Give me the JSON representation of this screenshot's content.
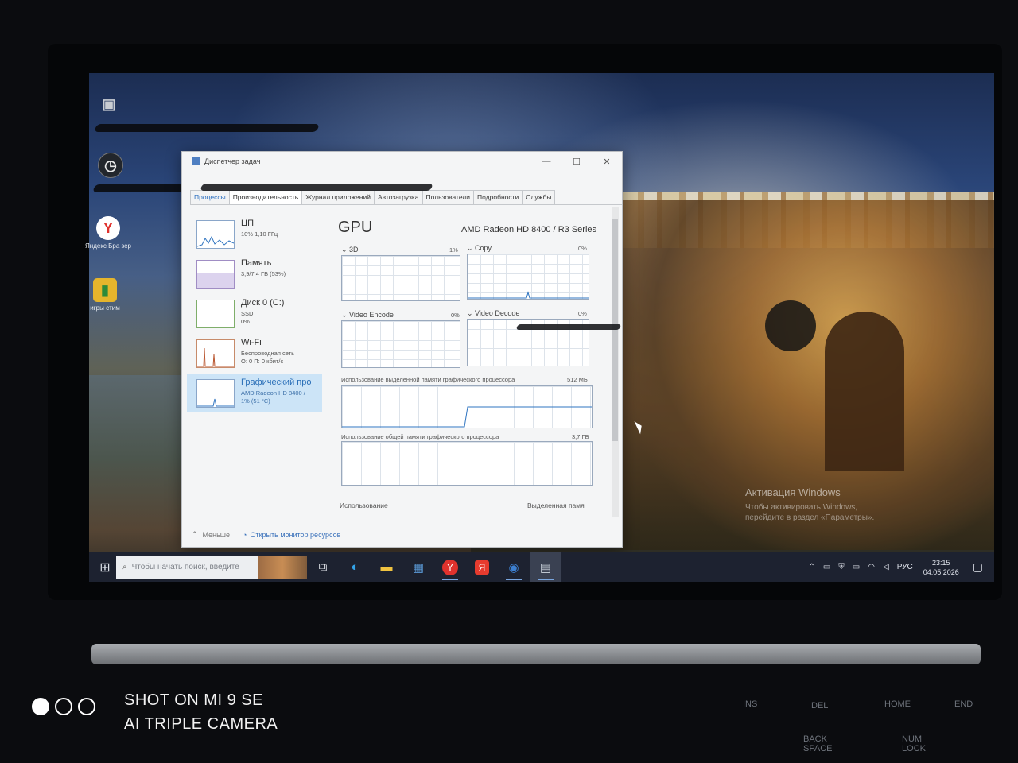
{
  "desktop": {
    "icons": [
      {
        "label": "",
        "glyph": "▣"
      },
      {
        "label": "",
        "glyph": "◷"
      },
      {
        "label": "Яндекс Бра зер",
        "glyph": "Y"
      },
      {
        "label": "игры стим",
        "glyph": "▮"
      }
    ],
    "activation_title": "Активация Windows",
    "activation_text": "Чтобы активировать Windows, перейдите в раздел «Параметры»."
  },
  "task_manager": {
    "title": "Диспетчер задач",
    "window_buttons": {
      "minimize": "—",
      "maximize": "☐",
      "close": "✕"
    },
    "tabs": [
      "Процессы",
      "Производительность",
      "Журнал приложений",
      "Автозагрузка",
      "Пользователи",
      "Подробности",
      "Службы"
    ],
    "active_tab": "Производительность",
    "resources": [
      {
        "name": "ЦП",
        "line1": "10% 1,10 ГГц",
        "line2": ""
      },
      {
        "name": "Память",
        "line1": "3,9/7,4 ГБ (53%)",
        "line2": ""
      },
      {
        "name": "Диск 0 (C:)",
        "line1": "SSD",
        "line2": "0%"
      },
      {
        "name": "Wi-Fi",
        "line1": "Беспроводная сеть",
        "line2": "О: 0 П: 0 кбит/с"
      },
      {
        "name": "Графический про",
        "line1": "AMD Radeon HD 8400 /",
        "line2": "1% (51 °C)"
      }
    ],
    "detail": {
      "title": "GPU",
      "model": "AMD Radeon HD 8400 / R3 Series",
      "engines": [
        {
          "label": "3D",
          "value": "1%"
        },
        {
          "label": "Copy",
          "value": "0%"
        },
        {
          "label": "Video Encode",
          "value": "0%"
        },
        {
          "label": "Video Decode",
          "value": "0%"
        }
      ],
      "dedicated_label": "Использование выделенной памяти графического процессора",
      "dedicated_value": "512 МБ",
      "shared_label": "Использование общей памяти графического процессора",
      "shared_value": "3,7 ГБ",
      "bottom_left": "Использование",
      "bottom_right": "Выделенная памя"
    },
    "footer": {
      "less": "Меньше",
      "monitor": "Открыть монитор ресурсов"
    }
  },
  "taskbar": {
    "search_placeholder": "Чтобы начать поиск, введите",
    "lang": "РУС",
    "time": "23:15",
    "date": "04.05.2026"
  },
  "keyboard": {
    "keys": [
      "INS",
      "DEL",
      "HOME",
      "END",
      "BACK SPACE",
      "NUM LOCK"
    ]
  },
  "watermark": {
    "line1": "SHOT ON MI 9 SE",
    "line2": "AI TRIPLE CAMERA"
  }
}
